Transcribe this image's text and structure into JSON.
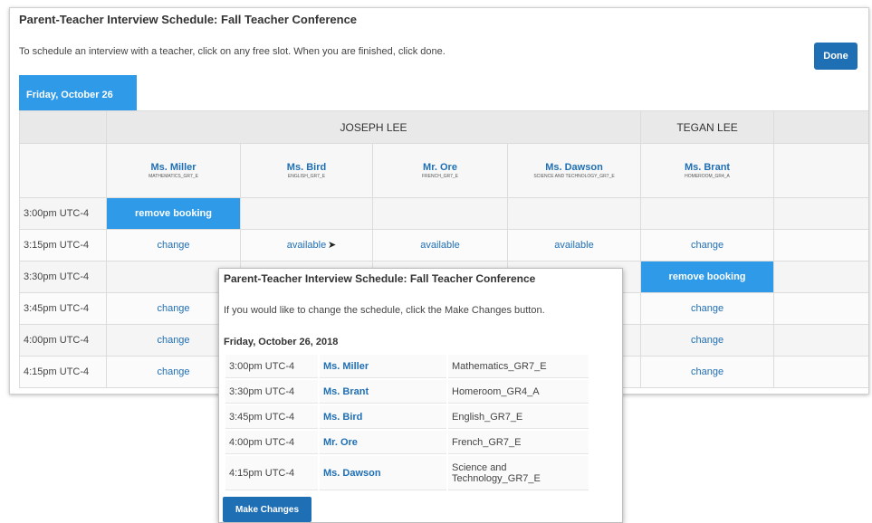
{
  "window": {
    "title": "Parent-Teacher Interview Schedule: Fall Teacher Conference",
    "instructions": "To schedule an interview with a teacher, click on any free slot. When you are finished, click done.",
    "done_label": "Done",
    "day_tab": "Friday, October 26"
  },
  "schedule": {
    "students": [
      "JOSEPH LEE",
      "TEGAN LEE"
    ],
    "teachers": [
      {
        "name": "Ms. Miller",
        "subject": "MATHEMATICS_GR7_E"
      },
      {
        "name": "Ms. Bird",
        "subject": "ENGLISH_GR7_E"
      },
      {
        "name": "Mr. Ore",
        "subject": "FRENCH_GR7_E"
      },
      {
        "name": "Ms. Dawson",
        "subject": "SCIENCE AND TECHNOLOGY_GR7_E"
      },
      {
        "name": "Ms. Brant",
        "subject": "HOMEROOM_GR4_A"
      }
    ],
    "rows": [
      {
        "time": "3:00pm UTC-4",
        "cells": [
          "remove booking",
          "",
          "",
          "",
          "",
          ""
        ]
      },
      {
        "time": "3:15pm UTC-4",
        "cells": [
          "change",
          "available",
          "available",
          "available",
          "change",
          ""
        ]
      },
      {
        "time": "3:30pm UTC-4",
        "cells": [
          "",
          "",
          "",
          "",
          "remove booking",
          ""
        ]
      },
      {
        "time": "3:45pm UTC-4",
        "cells": [
          "change",
          "",
          "",
          "",
          "change",
          ""
        ]
      },
      {
        "time": "4:00pm UTC-4",
        "cells": [
          "change",
          "",
          "",
          "",
          "change",
          ""
        ]
      },
      {
        "time": "4:15pm UTC-4",
        "cells": [
          "change",
          "",
          "",
          "",
          "change",
          ""
        ]
      }
    ]
  },
  "popup": {
    "title": "Parent-Teacher Interview Schedule: Fall Teacher Conference",
    "instructions": "If you would like to change the schedule, click the Make Changes button.",
    "date": "Friday, October 26, 2018",
    "bookings": [
      {
        "time": "3:00pm UTC-4",
        "teacher": "Ms. Miller",
        "course": "Mathematics_GR7_E"
      },
      {
        "time": "3:30pm UTC-4",
        "teacher": "Ms. Brant",
        "course": "Homeroom_GR4_A"
      },
      {
        "time": "3:45pm UTC-4",
        "teacher": "Ms. Bird",
        "course": "English_GR7_E"
      },
      {
        "time": "4:00pm UTC-4",
        "teacher": "Mr. Ore",
        "course": "French_GR7_E"
      },
      {
        "time": "4:15pm UTC-4",
        "teacher": "Ms. Dawson",
        "course": "Science and Technology_GR7_E"
      }
    ],
    "make_changes_label": "Make Changes"
  },
  "colors": {
    "accent": "#2e9ae8",
    "button": "#1f6fb5",
    "link": "#1f6fb5"
  },
  "icons": {
    "cursor": "mouse-pointer-icon"
  }
}
